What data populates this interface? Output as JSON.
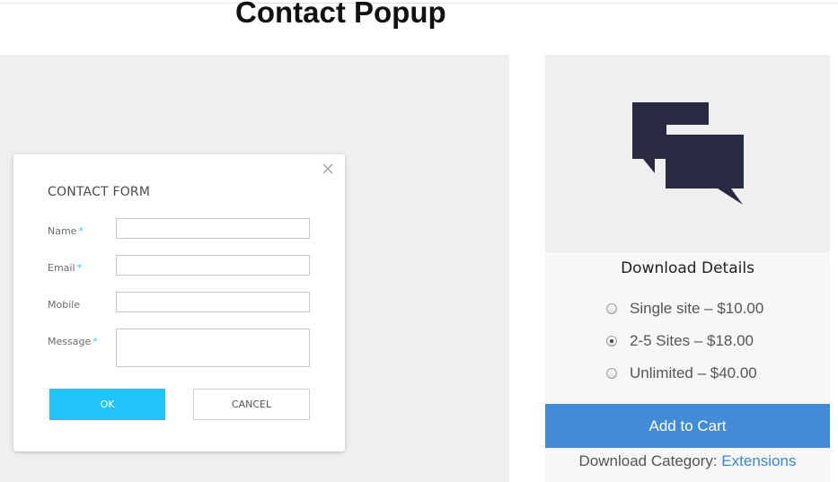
{
  "page": {
    "title": "Contact Popup"
  },
  "form": {
    "title": "CONTACT FORM",
    "close_icon": "close-icon",
    "fields": [
      {
        "label": "Name",
        "required": true,
        "required_mark": "*",
        "value": ""
      },
      {
        "label": "Email",
        "required": true,
        "required_mark": "*",
        "value": ""
      },
      {
        "label": "Mobile",
        "required": false,
        "required_mark": "",
        "value": ""
      },
      {
        "label": "Message",
        "required": true,
        "required_mark": "*",
        "value": ""
      }
    ],
    "ok_label": "OK",
    "cancel_label": "CANCEL"
  },
  "product": {
    "image_icon": "chat-bubbles-icon",
    "details_title": "Download Details",
    "price_options": [
      {
        "label": "Single site – $10.00",
        "selected": false
      },
      {
        "label": "2-5 Sites – $18.00",
        "selected": true
      },
      {
        "label": "Unlimited – $40.00",
        "selected": false
      }
    ],
    "add_to_cart_label": "Add to Cart",
    "category_label": "Download Category:",
    "category_link": "Extensions"
  },
  "colors": {
    "ok_button": "#22c4fb",
    "add_to_cart": "#428bd7",
    "link": "#3d87cf",
    "required_mark": "#2bc3f2",
    "icon": "#272a40"
  }
}
